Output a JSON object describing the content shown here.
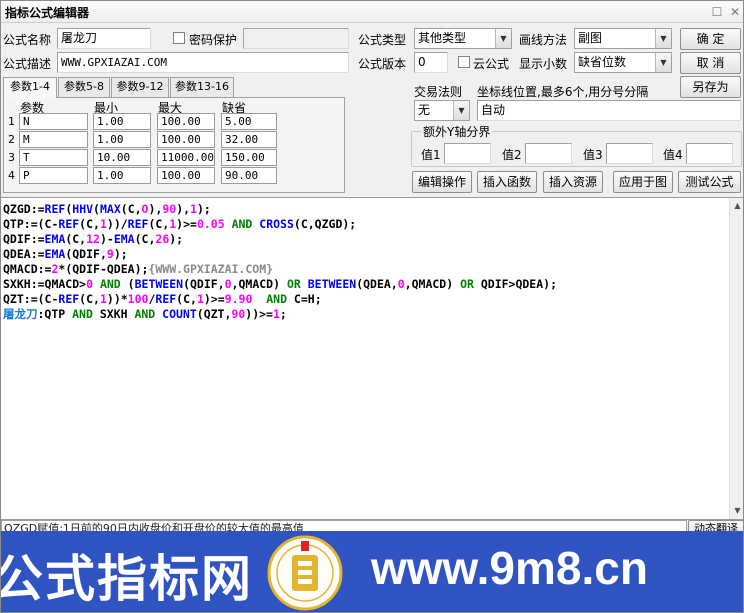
{
  "window": {
    "title": "指标公式编辑器",
    "min_glyph": "☐",
    "close_glyph": "✕"
  },
  "form": {
    "name_label": "公式名称",
    "name_value": "屠龙刀",
    "password_label": "密码保护",
    "desc_label": "公式描述",
    "desc_value": "WWW.GPXIAZAI.COM",
    "type_label": "公式类型",
    "type_value": "其他类型",
    "draw_label": "画线方法",
    "draw_value": "副图",
    "version_label": "公式版本",
    "version_value": "0",
    "cloud_label": "云公式",
    "decimal_label": "显示小数",
    "decimal_value": "缺省位数",
    "trade_label": "交易法则",
    "trade_value": "无",
    "coord_label": "坐标线位置,最多6个,用分号分隔",
    "coord_value": "自动",
    "yaxis_label": "额外Y轴分界",
    "val_labels": [
      "值1",
      "值2",
      "值3",
      "值4"
    ]
  },
  "buttons": {
    "ok": "确  定",
    "cancel": "取  消",
    "save_as": "另存为",
    "edit_op": "编辑操作",
    "insert_func": "插入函数",
    "insert_res": "插入资源",
    "apply_chart": "应用于图",
    "test_formula": "测试公式"
  },
  "tabs": [
    "参数1-4",
    "参数5-8",
    "参数9-12",
    "参数13-16"
  ],
  "params": {
    "headers": [
      "参数",
      "最小",
      "最大",
      "缺省"
    ],
    "rows": [
      {
        "idx": "1",
        "name": "N",
        "min": "1.00",
        "max": "100.00",
        "def": "5.00"
      },
      {
        "idx": "2",
        "name": "M",
        "min": "1.00",
        "max": "100.00",
        "def": "32.00"
      },
      {
        "idx": "3",
        "name": "T",
        "min": "10.00",
        "max": "11000.00",
        "def": "150.00"
      },
      {
        "idx": "4",
        "name": "P",
        "min": "1.00",
        "max": "100.00",
        "def": "90.00"
      }
    ]
  },
  "code": {
    "line1": [
      {
        "t": "QZGD:=",
        "c": "#000000"
      },
      {
        "t": "REF",
        "c": "#0000ff"
      },
      {
        "t": "(",
        "c": "#000000"
      },
      {
        "t": "HHV",
        "c": "#0000ff"
      },
      {
        "t": "(",
        "c": "#000000"
      },
      {
        "t": "MAX",
        "c": "#0000ff"
      },
      {
        "t": "(C,",
        "c": "#000000"
      },
      {
        "t": "O",
        "c": "#ff00ff"
      },
      {
        "t": "),",
        "c": "#000000"
      },
      {
        "t": "90",
        "c": "#ff00ff"
      },
      {
        "t": "),",
        "c": "#000000"
      },
      {
        "t": "1",
        "c": "#ff00ff"
      },
      {
        "t": ");",
        "c": "#000000"
      }
    ],
    "line2": [
      {
        "t": "QTP:=(C-",
        "c": "#000000"
      },
      {
        "t": "REF",
        "c": "#0000ff"
      },
      {
        "t": "(C,",
        "c": "#000000"
      },
      {
        "t": "1",
        "c": "#ff00ff"
      },
      {
        "t": "))/",
        "c": "#000000"
      },
      {
        "t": "REF",
        "c": "#0000ff"
      },
      {
        "t": "(C,",
        "c": "#000000"
      },
      {
        "t": "1",
        "c": "#ff00ff"
      },
      {
        "t": ")>=",
        "c": "#000000"
      },
      {
        "t": "0.05",
        "c": "#ff00ff"
      },
      {
        "t": " AND ",
        "c": "#008000"
      },
      {
        "t": "CROSS",
        "c": "#0000ff"
      },
      {
        "t": "(C,QZGD);",
        "c": "#000000"
      }
    ],
    "line3": [
      {
        "t": "QDIF:=",
        "c": "#000000"
      },
      {
        "t": "EMA",
        "c": "#0000ff"
      },
      {
        "t": "(C,",
        "c": "#000000"
      },
      {
        "t": "12",
        "c": "#ff00ff"
      },
      {
        "t": ")-",
        "c": "#000000"
      },
      {
        "t": "EMA",
        "c": "#0000ff"
      },
      {
        "t": "(C,",
        "c": "#000000"
      },
      {
        "t": "26",
        "c": "#ff00ff"
      },
      {
        "t": ");",
        "c": "#000000"
      }
    ],
    "line4": [
      {
        "t": "QDEA:=",
        "c": "#000000"
      },
      {
        "t": "EMA",
        "c": "#0000ff"
      },
      {
        "t": "(QDIF,",
        "c": "#000000"
      },
      {
        "t": "9",
        "c": "#ff00ff"
      },
      {
        "t": ");",
        "c": "#000000"
      }
    ],
    "line5": [
      {
        "t": "QMACD:=",
        "c": "#000000"
      },
      {
        "t": "2",
        "c": "#ff00ff"
      },
      {
        "t": "*(QDIF-QDEA);",
        "c": "#000000"
      },
      {
        "t": "{WWW.GPXIAZAI.COM}",
        "c": "#8a8a8a"
      }
    ],
    "line6": [
      {
        "t": "SXKH:=QMACD>",
        "c": "#000000"
      },
      {
        "t": "0",
        "c": "#ff00ff"
      },
      {
        "t": " AND ",
        "c": "#008000"
      },
      {
        "t": "(",
        "c": "#000000"
      },
      {
        "t": "BETWEEN",
        "c": "#0000ff"
      },
      {
        "t": "(QDIF,",
        "c": "#000000"
      },
      {
        "t": "0",
        "c": "#ff00ff"
      },
      {
        "t": ",QMACD)",
        "c": "#000000"
      },
      {
        "t": " OR ",
        "c": "#008000"
      },
      {
        "t": "BETWEEN",
        "c": "#0000ff"
      },
      {
        "t": "(QDEA,",
        "c": "#000000"
      },
      {
        "t": "0",
        "c": "#ff00ff"
      },
      {
        "t": ",QMACD)",
        "c": "#000000"
      },
      {
        "t": " OR ",
        "c": "#008000"
      },
      {
        "t": "QDIF>QDEA);",
        "c": "#000000"
      }
    ],
    "line7": [
      {
        "t": "QZT:=(C-",
        "c": "#000000"
      },
      {
        "t": "REF",
        "c": "#0000ff"
      },
      {
        "t": "(C,",
        "c": "#000000"
      },
      {
        "t": "1",
        "c": "#ff00ff"
      },
      {
        "t": "))*",
        "c": "#000000"
      },
      {
        "t": "100",
        "c": "#ff00ff"
      },
      {
        "t": "/",
        "c": "#000000"
      },
      {
        "t": "REF",
        "c": "#0000ff"
      },
      {
        "t": "(C,",
        "c": "#000000"
      },
      {
        "t": "1",
        "c": "#ff00ff"
      },
      {
        "t": ")>=",
        "c": "#000000"
      },
      {
        "t": "9.90",
        "c": "#ff00ff"
      },
      {
        "t": "  AND ",
        "c": "#008000"
      },
      {
        "t": "C=H;",
        "c": "#000000"
      }
    ],
    "line8": [
      {
        "t": "屠龙刀",
        "c": "#1a7ad8"
      },
      {
        "t": ":QTP",
        "c": "#000000"
      },
      {
        "t": " AND ",
        "c": "#008000"
      },
      {
        "t": "SXKH",
        "c": "#000000"
      },
      {
        "t": " AND ",
        "c": "#008000"
      },
      {
        "t": "COUNT",
        "c": "#0000ff"
      },
      {
        "t": "(QZT,",
        "c": "#000000"
      },
      {
        "t": "90",
        "c": "#ff00ff"
      },
      {
        "t": "))>=",
        "c": "#000000"
      },
      {
        "t": "1",
        "c": "#ff00ff"
      },
      {
        "t": ";",
        "c": "#000000"
      }
    ]
  },
  "status": {
    "hint": "QZGD赋值:1日前的90日内收盘价和开盘价的较大值的最高值",
    "dyn_translate": "动态翻译"
  },
  "banner": {
    "left_text": "公式指标网",
    "right_text": "www.9m8.cn",
    "seal_text": "www.9m8.cn"
  },
  "colors": {
    "banner_bg": "#2f54c2",
    "keyword_blue": "#0000ff",
    "number_magenta": "#ff00ff",
    "operator_green": "#008000",
    "comment_gray": "#8a8a8a"
  }
}
